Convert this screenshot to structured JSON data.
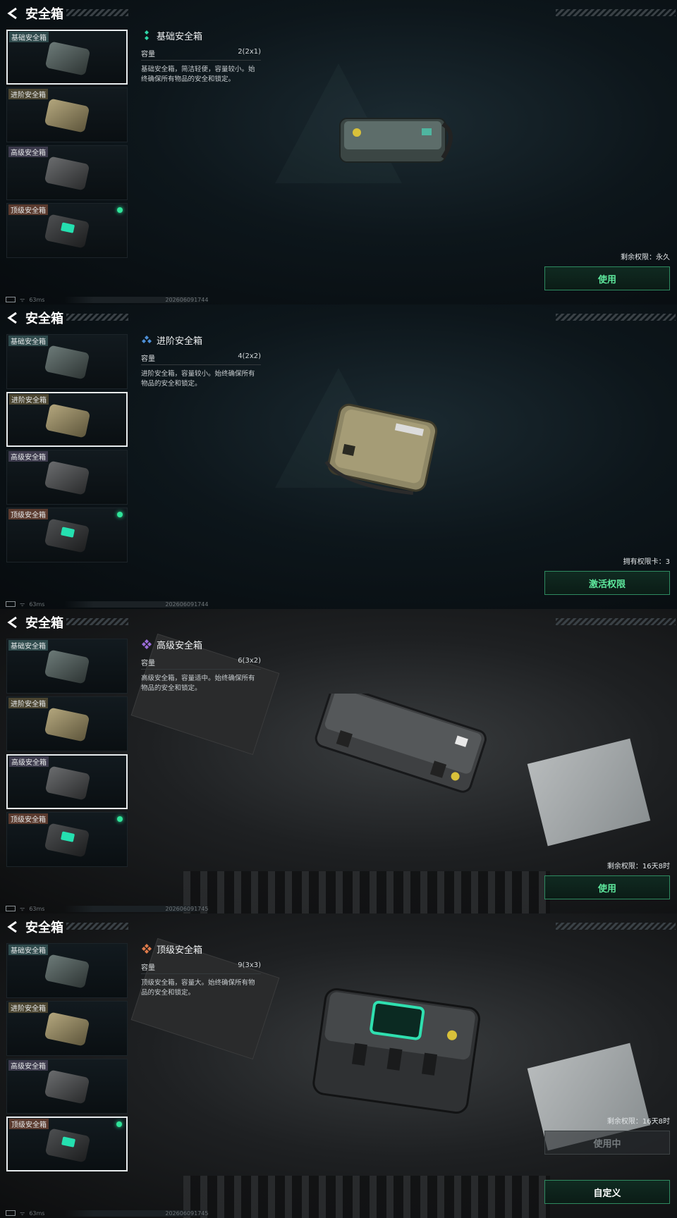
{
  "page_title": "安全箱",
  "items": [
    {
      "label": "基础安全箱"
    },
    {
      "label": "进阶安全箱"
    },
    {
      "label": "高级安全箱"
    },
    {
      "label": "顶级安全箱"
    }
  ],
  "capacity_label": "容量",
  "panels": [
    {
      "name": "基础安全箱",
      "capacity": "2(2x1)",
      "description": "基础安全箱，简洁轻便，容量较小。始终确保所有物品的安全和锁定。",
      "remain": "剩余权限：永久",
      "button": "使用",
      "status": {
        "ping": "63ms",
        "timestamp": "202606091744"
      }
    },
    {
      "name": "进阶安全箱",
      "capacity": "4(2x2)",
      "description": "进阶安全箱，容量较小。始终确保所有物品的安全和锁定。",
      "remain": "拥有权限卡：3",
      "button": "激活权限",
      "status": {
        "ping": "63ms",
        "timestamp": "202606091744"
      }
    },
    {
      "name": "高级安全箱",
      "capacity": "6(3x2)",
      "description": "高级安全箱，容量适中。始终确保所有物品的安全和锁定。",
      "remain": "剩余权限：16天8时",
      "button": "使用",
      "status": {
        "ping": "63ms",
        "timestamp": "202606091745"
      }
    },
    {
      "name": "顶级安全箱",
      "capacity": "9(3x3)",
      "description": "顶级安全箱，容量大。始终确保所有物品的安全和锁定。",
      "remain": "剩余权限：16天8时",
      "button_disabled": "使用中",
      "button": "自定义",
      "status": {
        "ping": "63ms",
        "timestamp": "202606091745"
      }
    }
  ],
  "colors": {
    "accent": "#5ee89d",
    "active_dot": "#2fe49a"
  }
}
